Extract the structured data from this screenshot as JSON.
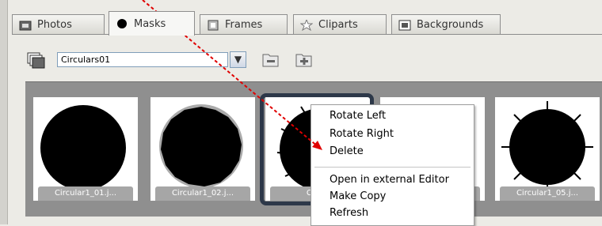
{
  "tabs": [
    {
      "label": "Photos",
      "icon": "photo-icon"
    },
    {
      "label": "Masks",
      "icon": "mask-icon",
      "active": true
    },
    {
      "label": "Frames",
      "icon": "frame-icon"
    },
    {
      "label": "Cliparts",
      "icon": "star-icon"
    },
    {
      "label": "Backgrounds",
      "icon": "background-icon"
    }
  ],
  "toolbar": {
    "selected_folder": "Circulars01",
    "icons": [
      "folder-stack-icon",
      "chevron-down-icon",
      "remove-folder-icon",
      "add-folder-icon"
    ]
  },
  "thumbnails": [
    {
      "label": "Circular1_01.j..."
    },
    {
      "label": "Circular1_02.j..."
    },
    {
      "label": "Circul"
    },
    {
      "label": ""
    },
    {
      "label": "Circular1_05.j..."
    }
  ],
  "context_menu": {
    "items": [
      "Rotate Left",
      "Rotate Right",
      "Delete",
      "Open in external Editor",
      "Make Copy",
      "Refresh"
    ]
  },
  "colors": {
    "annotation_arrow": "#e00000",
    "selection_border": "#2d3849"
  }
}
